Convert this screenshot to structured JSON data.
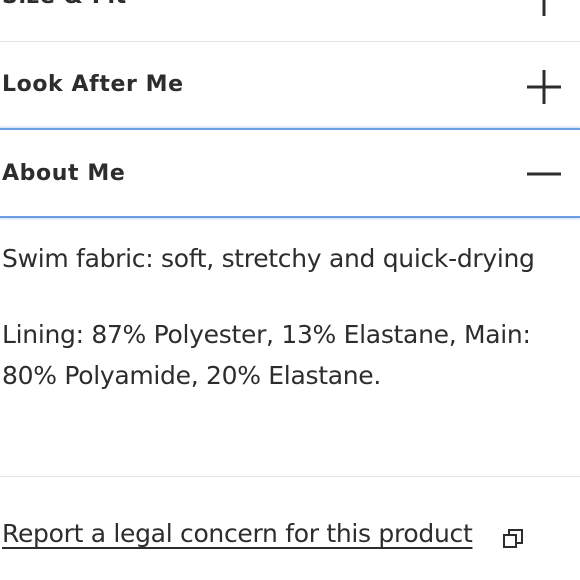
{
  "accordion": {
    "size_fit": {
      "label": "Size & Fit",
      "icon": "plus-icon"
    },
    "look_after": {
      "label": "Look After Me",
      "icon": "plus-icon"
    },
    "about": {
      "label": "About Me",
      "icon": "minus-icon"
    }
  },
  "about_content": {
    "line1": "Swim fabric: soft, stretchy and quick-drying",
    "line2": "Lining: 87% Polyester, 13% Elastane, Main: 80% Polyamide, 20% Elastane."
  },
  "legal": {
    "link_text": "Report a legal concern for this product",
    "icon": "external-link-icon"
  },
  "colors": {
    "text": "#2d2d2d",
    "focus_outline": "#6a9fe6",
    "divider": "#e2e2e2"
  }
}
